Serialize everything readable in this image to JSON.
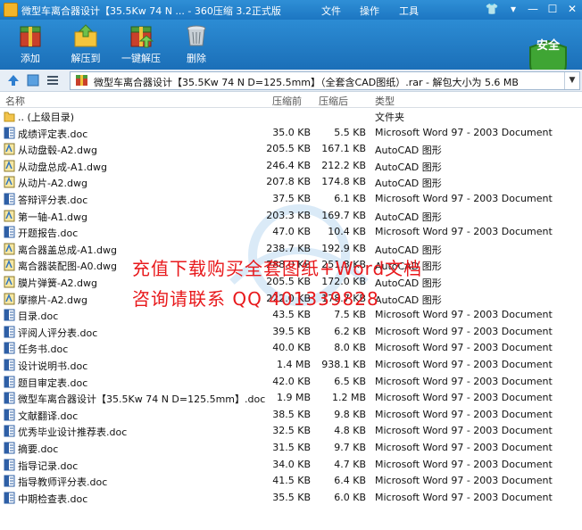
{
  "window": {
    "title": "微型车离合器设计【35.5Kw 74 N ... - 360压缩 3.2正式版",
    "menu": [
      "文件",
      "操作",
      "工具"
    ]
  },
  "toolbar": {
    "buttons": [
      {
        "label": "添加",
        "icon": "add-archive-icon"
      },
      {
        "label": "解压到",
        "icon": "extract-to-icon"
      },
      {
        "label": "一键解压",
        "icon": "one-click-extract-icon"
      },
      {
        "label": "删除",
        "icon": "delete-icon"
      }
    ],
    "safe_label": "安全"
  },
  "address": {
    "path": "微型车离合器设计【35.5Kw 74 N   D=125.5mm】（全套含CAD图纸）.rar - 解包大小为 5.6 MB"
  },
  "columns": {
    "name": "名称",
    "size": "压缩前",
    "csize": "压缩后",
    "type": "类型"
  },
  "files": [
    {
      "name": ".. (上级目录)",
      "size": "",
      "csize": "",
      "type": "文件夹",
      "kind": "folder"
    },
    {
      "name": "成绩评定表.doc",
      "size": "35.0 KB",
      "csize": "5.5 KB",
      "type": "Microsoft Word 97 - 2003 Document",
      "kind": "doc"
    },
    {
      "name": "从动盘毂-A2.dwg",
      "size": "205.5 KB",
      "csize": "167.1 KB",
      "type": "AutoCAD 图形",
      "kind": "dwg"
    },
    {
      "name": "从动盘总成-A1.dwg",
      "size": "246.4 KB",
      "csize": "212.2 KB",
      "type": "AutoCAD 图形",
      "kind": "dwg"
    },
    {
      "name": "从动片-A2.dwg",
      "size": "207.8 KB",
      "csize": "174.8 KB",
      "type": "AutoCAD 图形",
      "kind": "dwg"
    },
    {
      "name": "答辩评分表.doc",
      "size": "37.5 KB",
      "csize": "6.1 KB",
      "type": "Microsoft Word 97 - 2003 Document",
      "kind": "doc"
    },
    {
      "name": "第一轴-A1.dwg",
      "size": "203.3 KB",
      "csize": "169.7 KB",
      "type": "AutoCAD 图形",
      "kind": "dwg"
    },
    {
      "name": "开题报告.doc",
      "size": "47.0 KB",
      "csize": "10.4 KB",
      "type": "Microsoft Word 97 - 2003 Document",
      "kind": "doc"
    },
    {
      "name": "离合器盖总成-A1.dwg",
      "size": "238.7 KB",
      "csize": "192.9 KB",
      "type": "AutoCAD 图形",
      "kind": "dwg"
    },
    {
      "name": "离合器装配图-A0.dwg",
      "size": "288.0 KB",
      "csize": "251.3 KB",
      "type": "AutoCAD 图形",
      "kind": "dwg"
    },
    {
      "name": "膜片弹簧-A2.dwg",
      "size": "205.5 KB",
      "csize": "172.0 KB",
      "type": "AutoCAD 图形",
      "kind": "dwg"
    },
    {
      "name": "摩擦片-A2.dwg",
      "size": "222.0 KB",
      "csize": "178.7 KB",
      "type": "AutoCAD 图形",
      "kind": "dwg"
    },
    {
      "name": "目录.doc",
      "size": "43.5 KB",
      "csize": "7.5 KB",
      "type": "Microsoft Word 97 - 2003 Document",
      "kind": "doc"
    },
    {
      "name": "评阅人评分表.doc",
      "size": "39.5 KB",
      "csize": "6.2 KB",
      "type": "Microsoft Word 97 - 2003 Document",
      "kind": "doc"
    },
    {
      "name": "任务书.doc",
      "size": "40.0 KB",
      "csize": "8.0 KB",
      "type": "Microsoft Word 97 - 2003 Document",
      "kind": "doc"
    },
    {
      "name": "设计说明书.doc",
      "size": "1.4 MB",
      "csize": "938.1 KB",
      "type": "Microsoft Word 97 - 2003 Document",
      "kind": "doc"
    },
    {
      "name": "题目审定表.doc",
      "size": "42.0 KB",
      "csize": "6.5 KB",
      "type": "Microsoft Word 97 - 2003 Document",
      "kind": "doc"
    },
    {
      "name": "微型车离合器设计【35.5Kw 74 N   D=125.5mm】.doc",
      "size": "1.9 MB",
      "csize": "1.2 MB",
      "type": "Microsoft Word 97 - 2003 Document",
      "kind": "doc"
    },
    {
      "name": "文献翻译.doc",
      "size": "38.5 KB",
      "csize": "9.8 KB",
      "type": "Microsoft Word 97 - 2003 Document",
      "kind": "doc"
    },
    {
      "name": "优秀毕业设计推荐表.doc",
      "size": "32.5 KB",
      "csize": "4.8 KB",
      "type": "Microsoft Word 97 - 2003 Document",
      "kind": "doc"
    },
    {
      "name": "摘要.doc",
      "size": "31.5 KB",
      "csize": "9.7 KB",
      "type": "Microsoft Word 97 - 2003 Document",
      "kind": "doc"
    },
    {
      "name": "指导记录.doc",
      "size": "34.0 KB",
      "csize": "4.7 KB",
      "type": "Microsoft Word 97 - 2003 Document",
      "kind": "doc"
    },
    {
      "name": "指导教师评分表.doc",
      "size": "41.5 KB",
      "csize": "6.4 KB",
      "type": "Microsoft Word 97 - 2003 Document",
      "kind": "doc"
    },
    {
      "name": "中期检查表.doc",
      "size": "35.5 KB",
      "csize": "6.0 KB",
      "type": "Microsoft Word 97 - 2003 Document",
      "kind": "doc"
    }
  ],
  "watermark": {
    "line1": "充值下载购买全套图纸+Word文档",
    "line2": "咨询请联系  QQ 401339828"
  },
  "colors": {
    "titlebar": "#1c76c2",
    "watermark": "#e8191c",
    "shield": "#3fa534"
  }
}
